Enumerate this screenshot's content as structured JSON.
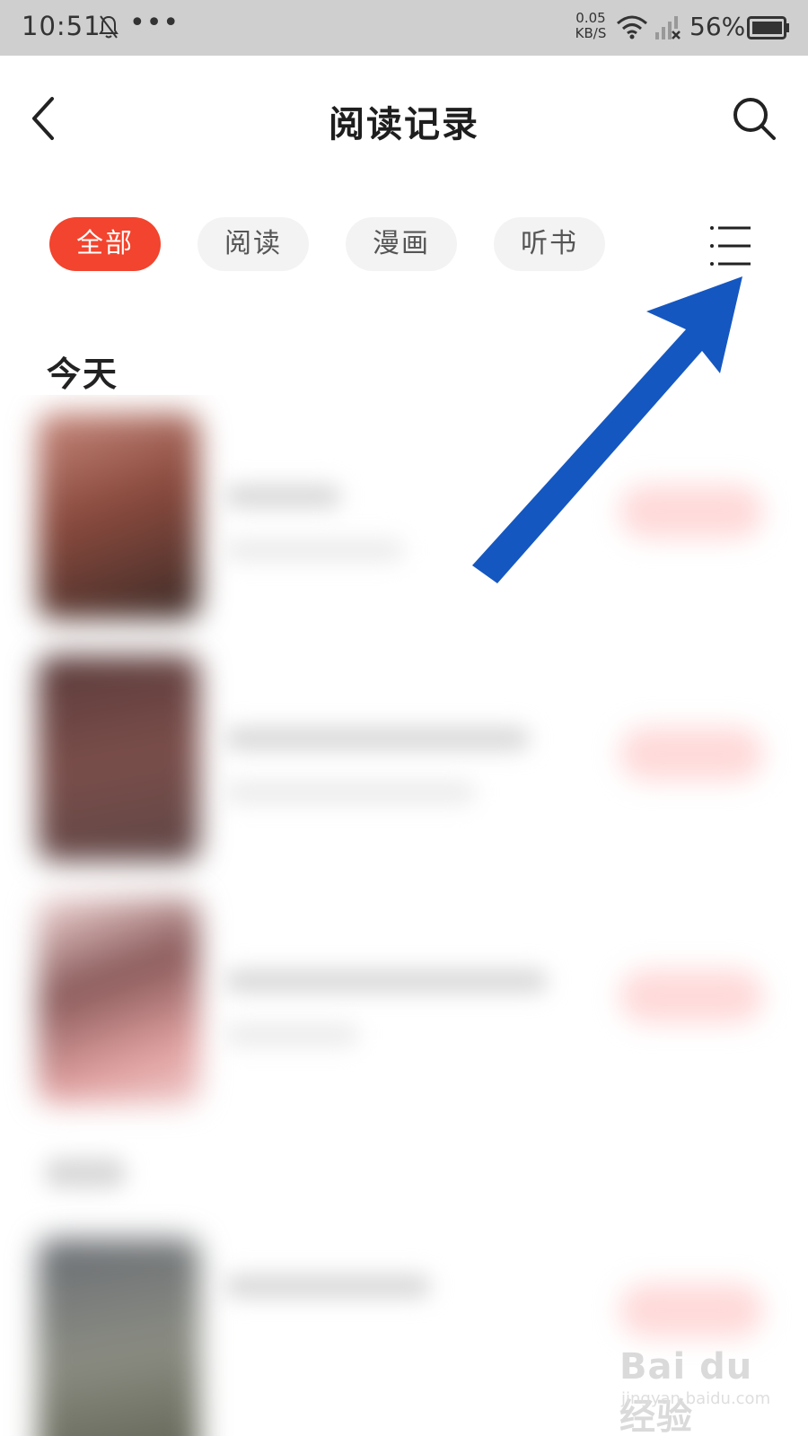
{
  "status_bar": {
    "time": "10:51",
    "dots": "•••",
    "net_speed_value": "0.05",
    "net_speed_unit": "KB/S",
    "battery_percent": "56%"
  },
  "header": {
    "title": "阅读记录"
  },
  "tabs": [
    {
      "label": "全部",
      "active": true
    },
    {
      "label": "阅读",
      "active": false
    },
    {
      "label": "漫画",
      "active": false
    },
    {
      "label": "听书",
      "active": false
    }
  ],
  "section": {
    "title": "今天"
  },
  "colors": {
    "accent": "#f2442e",
    "arrow": "#1557c0",
    "status_bar_bg": "#cfcfcf"
  },
  "watermark": {
    "logo": "Bai du 经验",
    "url": "jingyan.baidu.com"
  }
}
